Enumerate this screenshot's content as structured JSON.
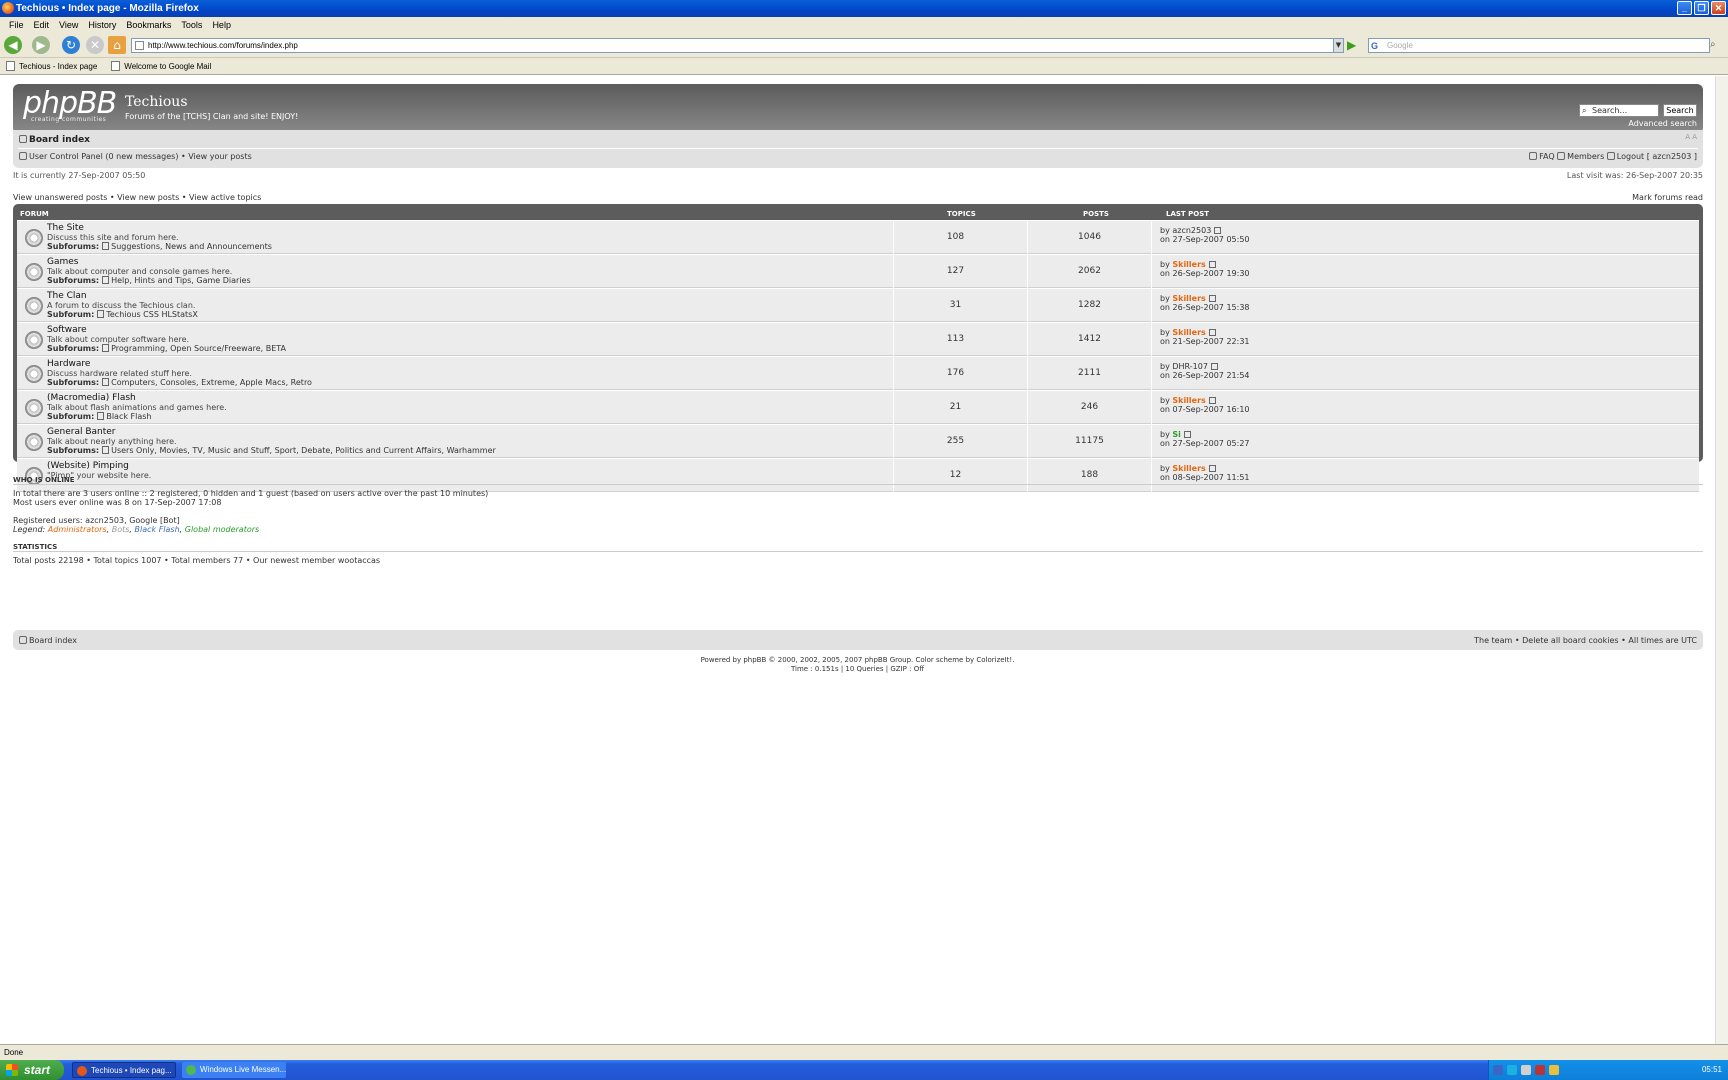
{
  "window": {
    "title": "Techious • Index page - Mozilla Firefox"
  },
  "menu": [
    "File",
    "Edit",
    "View",
    "History",
    "Bookmarks",
    "Tools",
    "Help"
  ],
  "url": "http://www.techious.com/forums/index.php",
  "search_engine_placeholder": "Google",
  "bookmarks": [
    "Techious - Index page",
    "Welcome to Google Mail"
  ],
  "site": {
    "logo": "phpBB",
    "logo_sub": "creating communities",
    "title": "Techious",
    "description": "Forums of the [TCHS] Clan and site! ENJOY!",
    "search_placeholder": "Search...",
    "search_button": "Search",
    "advanced_search": "Advanced search"
  },
  "nav": {
    "board_index": "Board index",
    "ucp": "User Control Panel (0 new messages) • View your posts",
    "faq": "FAQ",
    "members": "Members",
    "logout": "Logout [ azcn2503 ]"
  },
  "time_line": "It is currently 27-Sep-2007 05:50",
  "last_visit": "Last visit was: 26-Sep-2007 20:35",
  "quick_links": "View unanswered posts • View new posts • View active topics",
  "mark_read": "Mark forums read",
  "table_headers": {
    "forum": "FORUM",
    "topics": "TOPICS",
    "posts": "POSTS",
    "last_post": "LAST POST"
  },
  "forums": [
    {
      "name": "The Site",
      "desc": "Discuss this site and forum here.",
      "sub_label": "Subforums:",
      "subs": "Suggestions, News and Announcements",
      "topics": "108",
      "posts": "1046",
      "by": "azcn2503",
      "role": "",
      "on": "on 27-Sep-2007 05:50"
    },
    {
      "name": "Games",
      "desc": "Talk about computer and console games here.",
      "sub_label": "Subforums:",
      "subs": "Help, Hints and Tips, Game Diaries",
      "topics": "127",
      "posts": "2062",
      "by": "Skillers",
      "role": "admin",
      "on": "on 26-Sep-2007 19:30"
    },
    {
      "name": "The Clan",
      "desc": "A forum to discuss the Techious clan.",
      "sub_label": "Subforum:",
      "subs": "Techious CSS HLStatsX",
      "topics": "31",
      "posts": "1282",
      "by": "Skillers",
      "role": "admin",
      "on": "on 26-Sep-2007 15:38"
    },
    {
      "name": "Software",
      "desc": "Talk about computer software here.",
      "sub_label": "Subforums:",
      "subs": "Programming, Open Source/Freeware, BETA",
      "topics": "113",
      "posts": "1412",
      "by": "Skillers",
      "role": "admin",
      "on": "on 21-Sep-2007 22:31"
    },
    {
      "name": "Hardware",
      "desc": "Discuss hardware related stuff here.",
      "sub_label": "Subforums:",
      "subs": "Computers, Consoles, Extreme, Apple Macs, Retro",
      "topics": "176",
      "posts": "2111",
      "by": "DHR-107",
      "role": "",
      "on": "on 26-Sep-2007 21:54"
    },
    {
      "name": "(Macromedia) Flash",
      "desc": "Talk about flash animations and games here.",
      "sub_label": "Subforum:",
      "subs": "Black Flash",
      "topics": "21",
      "posts": "246",
      "by": "Skillers",
      "role": "admin",
      "on": "on 07-Sep-2007 16:10"
    },
    {
      "name": "General Banter",
      "desc": "Talk about nearly anything here.",
      "sub_label": "Subforums:",
      "subs": "Users Only, Movies, TV, Music and Stuff, Sport, Debate, Politics and Current Affairs, Warhammer",
      "topics": "255",
      "posts": "11175",
      "by": "Si",
      "role": "gm",
      "on": "on 27-Sep-2007 05:27"
    },
    {
      "name": "(Website) Pimping",
      "desc": "\"Pimp\" your website here.",
      "sub_label": "",
      "subs": "",
      "topics": "12",
      "posts": "188",
      "by": "Skillers",
      "role": "admin",
      "on": "on 08-Sep-2007 11:51"
    }
  ],
  "who_is_online": {
    "title": "WHO IS ONLINE",
    "line1": "In total there are 3 users online :: 2 registered, 0 hidden and 1 guest (based on users active over the past 10 minutes)",
    "line2": "Most users ever online was 8 on 17-Sep-2007 17:08",
    "registered_label": "Registered users:",
    "registered_users": "azcn2503, Google [Bot]",
    "legend_label": "Legend:",
    "legend": [
      "Administrators",
      "Bots",
      "Black Flash",
      "Global moderators"
    ]
  },
  "statistics": {
    "title": "STATISTICS",
    "line": "Total posts 22198 • Total topics 1007 • Total members 77 • Our newest member wootaccas"
  },
  "footer": {
    "board_index": "Board index",
    "right": "The team • Delete all board cookies • All times are UTC",
    "credits1": "Powered by phpBB © 2000, 2002, 2005, 2007 phpBB Group. Color scheme by ColorizeIt!.",
    "credits2": "Time : 0.151s | 10 Queries | GZIP : Off"
  },
  "status": "Done",
  "taskbar": {
    "start": "start",
    "tasks": [
      "Techious • Index pag...",
      "Windows Live Messen..."
    ],
    "clock": "05:51"
  },
  "colors": {
    "admin": "#e06810",
    "gm": "#2b9d2b",
    "black_flash": "#3f6fb5",
    "header": "#6e6e6e"
  }
}
